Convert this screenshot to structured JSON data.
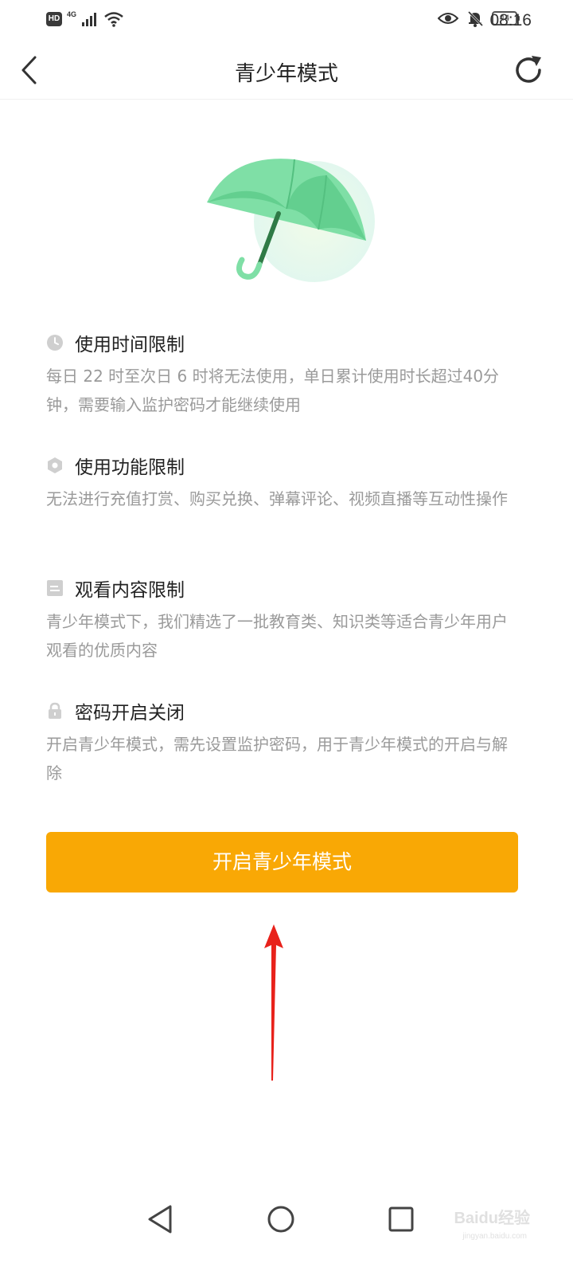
{
  "status_bar": {
    "hd_badge": "HD",
    "network": "4G",
    "battery_level": "44",
    "time": "08:16",
    "icons": [
      "signal-icon",
      "wifi-icon",
      "eye-icon",
      "bell-muted-icon",
      "battery-icon"
    ]
  },
  "header": {
    "title": "青少年模式",
    "back_icon": "chevron-left-icon",
    "refresh_icon": "refresh-icon"
  },
  "illustration": {
    "icon": "umbrella-icon"
  },
  "features": [
    {
      "icon": "clock-icon",
      "title": "使用时间限制",
      "desc": "每日 22 时至次日 6 时将无法使用，单日累计使用时长超过40分钟，需要输入监护密码才能继续使用"
    },
    {
      "icon": "hexagon-icon",
      "title": "使用功能限制",
      "desc": "无法进行充值打赏、购买兑换、弹幕评论、视频直播等互动性操作"
    },
    {
      "icon": "content-icon",
      "title": "观看内容限制",
      "desc": "青少年模式下，我们精选了一批教育类、知识类等适合青少年用户观看的优质内容"
    },
    {
      "icon": "lock-icon",
      "title": "密码开启关闭",
      "desc": "开启青少年模式，需先设置监护密码，用于青少年模式的开启与解除"
    }
  ],
  "cta_label": "开启青少年模式",
  "watermark": {
    "brand": "Baidu经验",
    "url": "jingyan.baidu.com"
  },
  "colors": {
    "accent": "#f9a805",
    "umbrella": "#6fd39a",
    "desc_text": "#9a9a9a",
    "annotation_arrow": "#e8221b"
  },
  "navbar": {
    "icons": [
      "back-triangle-icon",
      "home-circle-icon",
      "recents-square-icon"
    ]
  }
}
